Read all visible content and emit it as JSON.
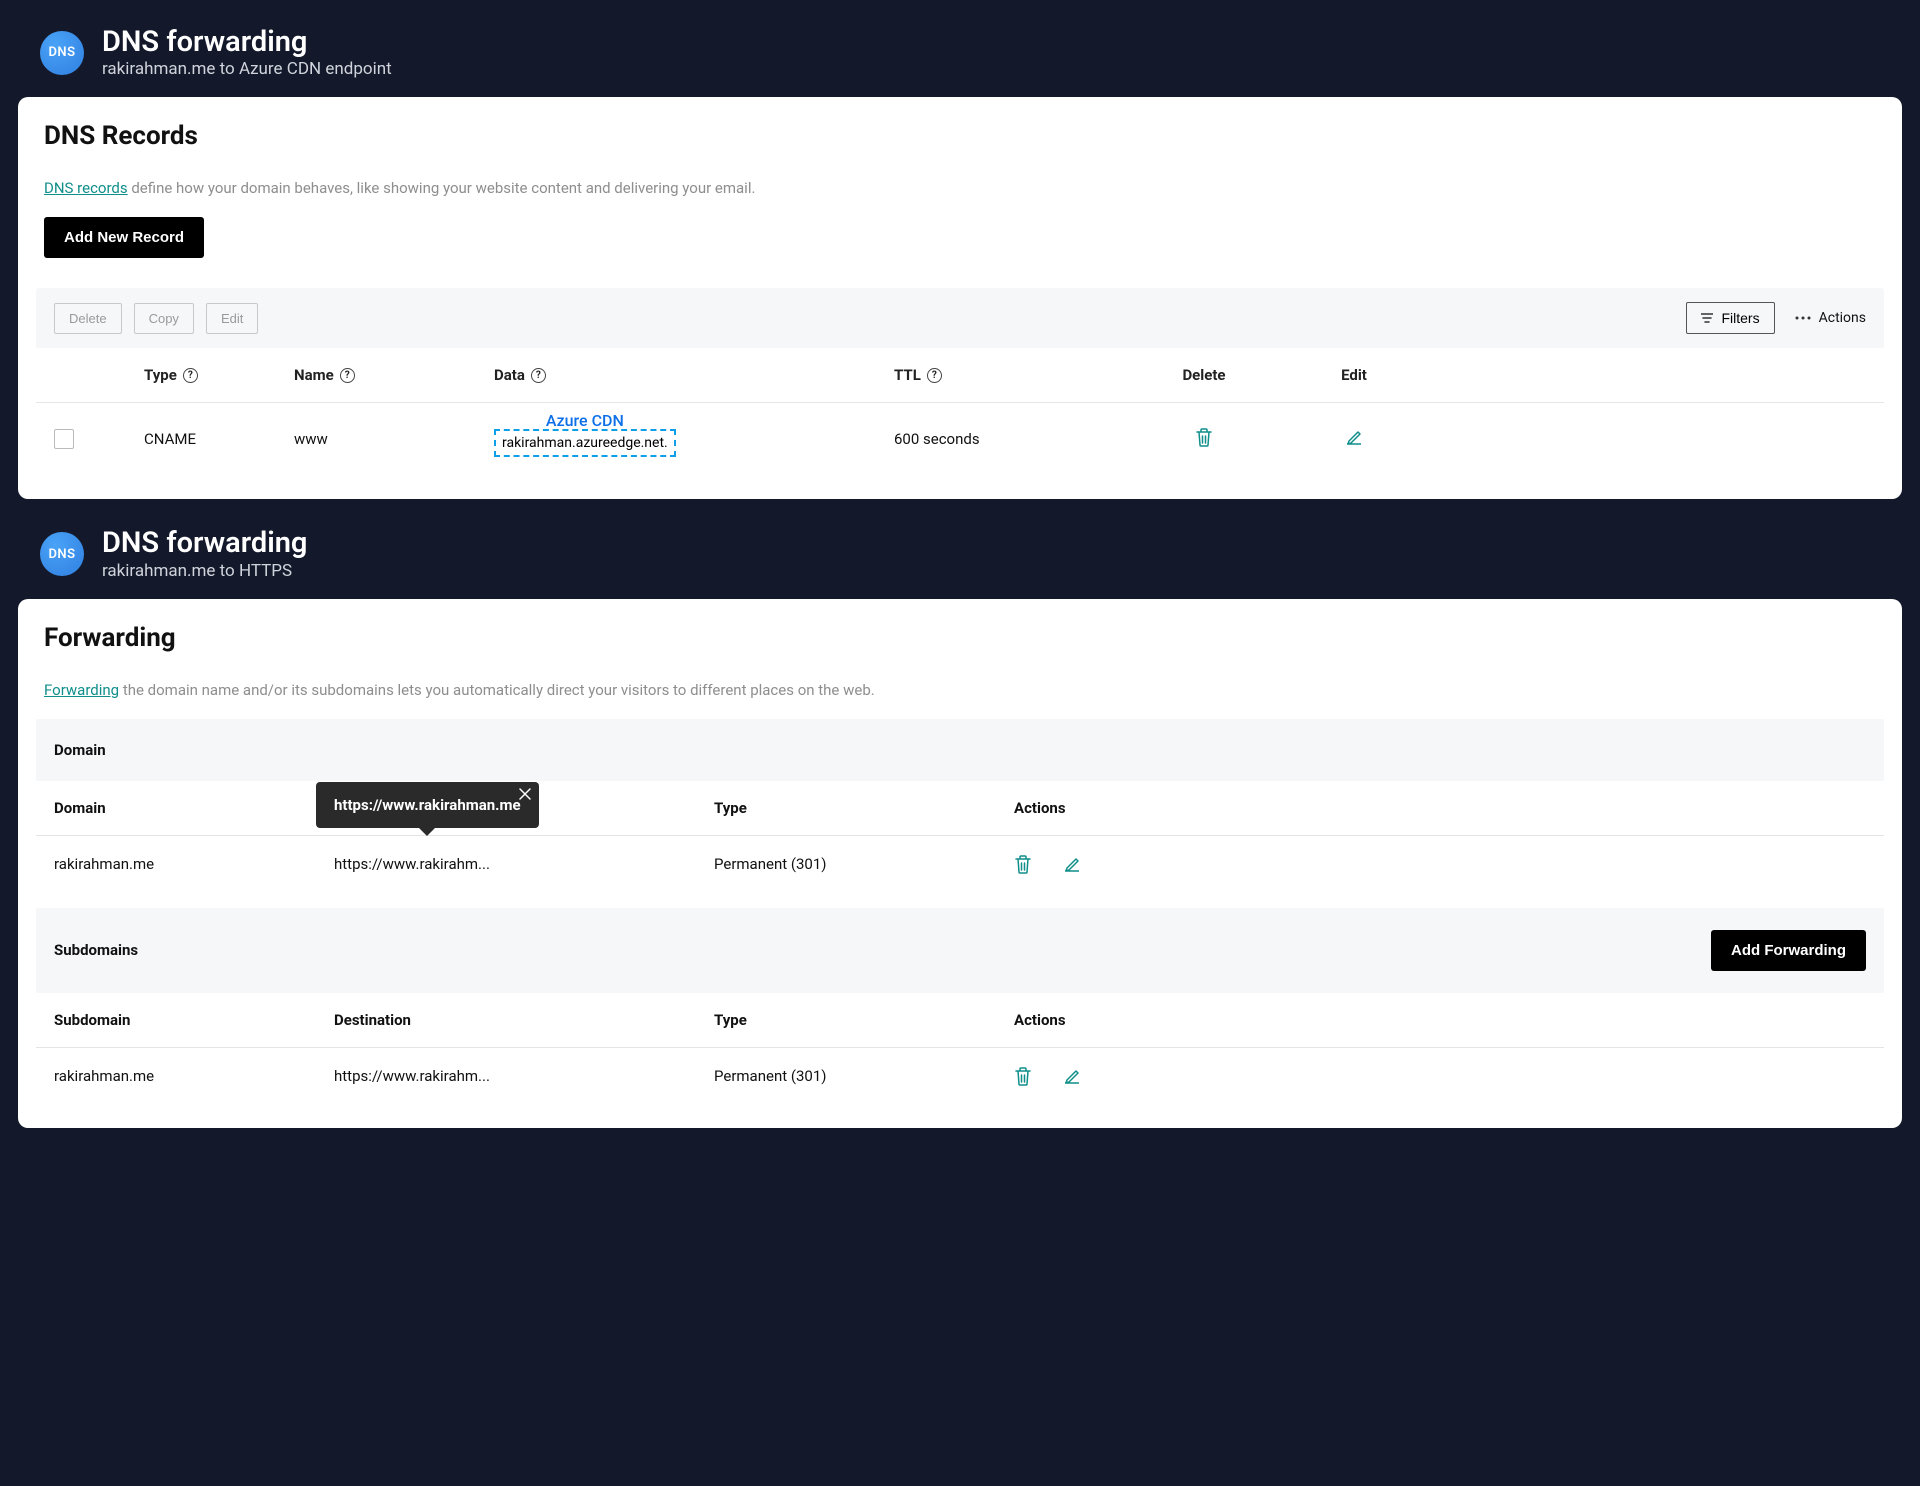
{
  "dns_badge": "DNS",
  "header1": {
    "title": "DNS forwarding",
    "subtitle": "rakirahman.me to Azure CDN endpoint"
  },
  "card1": {
    "title": "DNS Records",
    "intro_link": "DNS records",
    "intro_rest": " define how your domain behaves, like showing your website content and delivering your email.",
    "add_button": "Add New Record",
    "toolbar": {
      "delete": "Delete",
      "copy": "Copy",
      "edit": "Edit",
      "filters": "Filters",
      "actions": "Actions"
    },
    "columns": {
      "type": "Type",
      "name": "Name",
      "data": "Data",
      "ttl": "TTL",
      "delete": "Delete",
      "edit": "Edit"
    },
    "row": {
      "type": "CNAME",
      "name": "www",
      "data_label": "Azure CDN",
      "data_value": "rakirahman.azureedge.net.",
      "ttl": "600 seconds"
    }
  },
  "header2": {
    "title": "DNS forwarding",
    "subtitle": "rakirahman.me to HTTPS"
  },
  "card2": {
    "title": "Forwarding",
    "intro_link": "Forwarding",
    "intro_rest": " the domain name and/or its subdomains lets you automatically direct your visitors to different places on the web.",
    "section_domain": "Domain",
    "columns": {
      "domain": "Domain",
      "type": "Type",
      "actions": "Actions",
      "subdomain": "Subdomain",
      "destination": "Destination"
    },
    "row_domain": {
      "domain": "rakirahman.me",
      "dest_short": "https://www.rakirahm...",
      "type": "Permanent (301)"
    },
    "tooltip_text": "https://www.rakirahman.me",
    "section_subdomains": "Subdomains",
    "add_forwarding": "Add Forwarding",
    "row_subdomain": {
      "subdomain": "rakirahman.me",
      "dest_short": "https://www.rakirahm...",
      "type": "Permanent (301)"
    }
  }
}
